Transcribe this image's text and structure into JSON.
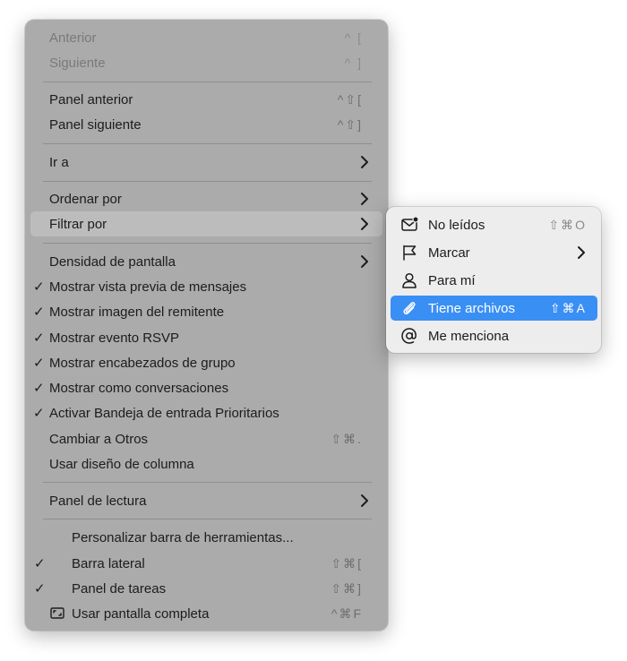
{
  "main_menu": {
    "items": [
      {
        "label": "Anterior",
        "shortcut": "^ ["
      },
      {
        "label": "Siguiente",
        "shortcut": "^ ]"
      },
      {
        "label": "Panel anterior",
        "shortcut": "^⇧["
      },
      {
        "label": "Panel siguiente",
        "shortcut": "^⇧]"
      },
      {
        "label": "Ir a"
      },
      {
        "label": "Ordenar por"
      },
      {
        "label": "Filtrar por"
      },
      {
        "label": "Densidad de pantalla"
      },
      {
        "label": "Mostrar vista previa de mensajes",
        "check": "✓"
      },
      {
        "label": "Mostrar imagen del remitente",
        "check": "✓"
      },
      {
        "label": "Mostrar evento RSVP",
        "check": "✓"
      },
      {
        "label": "Mostrar encabezados de grupo",
        "check": "✓"
      },
      {
        "label": "Mostrar como conversaciones",
        "check": "✓"
      },
      {
        "label": "Activar Bandeja de entrada Prioritarios",
        "check": "✓"
      },
      {
        "label": "Cambiar a Otros",
        "shortcut": "⇧⌘."
      },
      {
        "label": "Usar diseño de columna"
      },
      {
        "label": "Panel de lectura"
      },
      {
        "label": "Personalizar barra de herramientas..."
      },
      {
        "label": "Barra lateral",
        "check": "✓",
        "shortcut": "⇧⌘["
      },
      {
        "label": "Panel de tareas",
        "check": "✓",
        "shortcut": "⇧⌘]"
      },
      {
        "label": "Usar pantalla completa",
        "shortcut": "^⌘F"
      }
    ]
  },
  "submenu": {
    "items": [
      {
        "label": "No leídos",
        "shortcut": "⇧⌘O",
        "icon": "unread-mail-icon"
      },
      {
        "label": "Marcar",
        "icon": "flag-icon"
      },
      {
        "label": "Para mí",
        "icon": "person-icon"
      },
      {
        "label": "Tiene archivos",
        "shortcut": "⇧⌘A",
        "icon": "paperclip-icon"
      },
      {
        "label": "Me menciona",
        "icon": "at-sign-icon"
      }
    ]
  },
  "colors": {
    "menu_background": "#ababab",
    "submenu_background": "#ededed",
    "highlight": "#3a8ff5",
    "hover_row": "#bcbcbc"
  }
}
